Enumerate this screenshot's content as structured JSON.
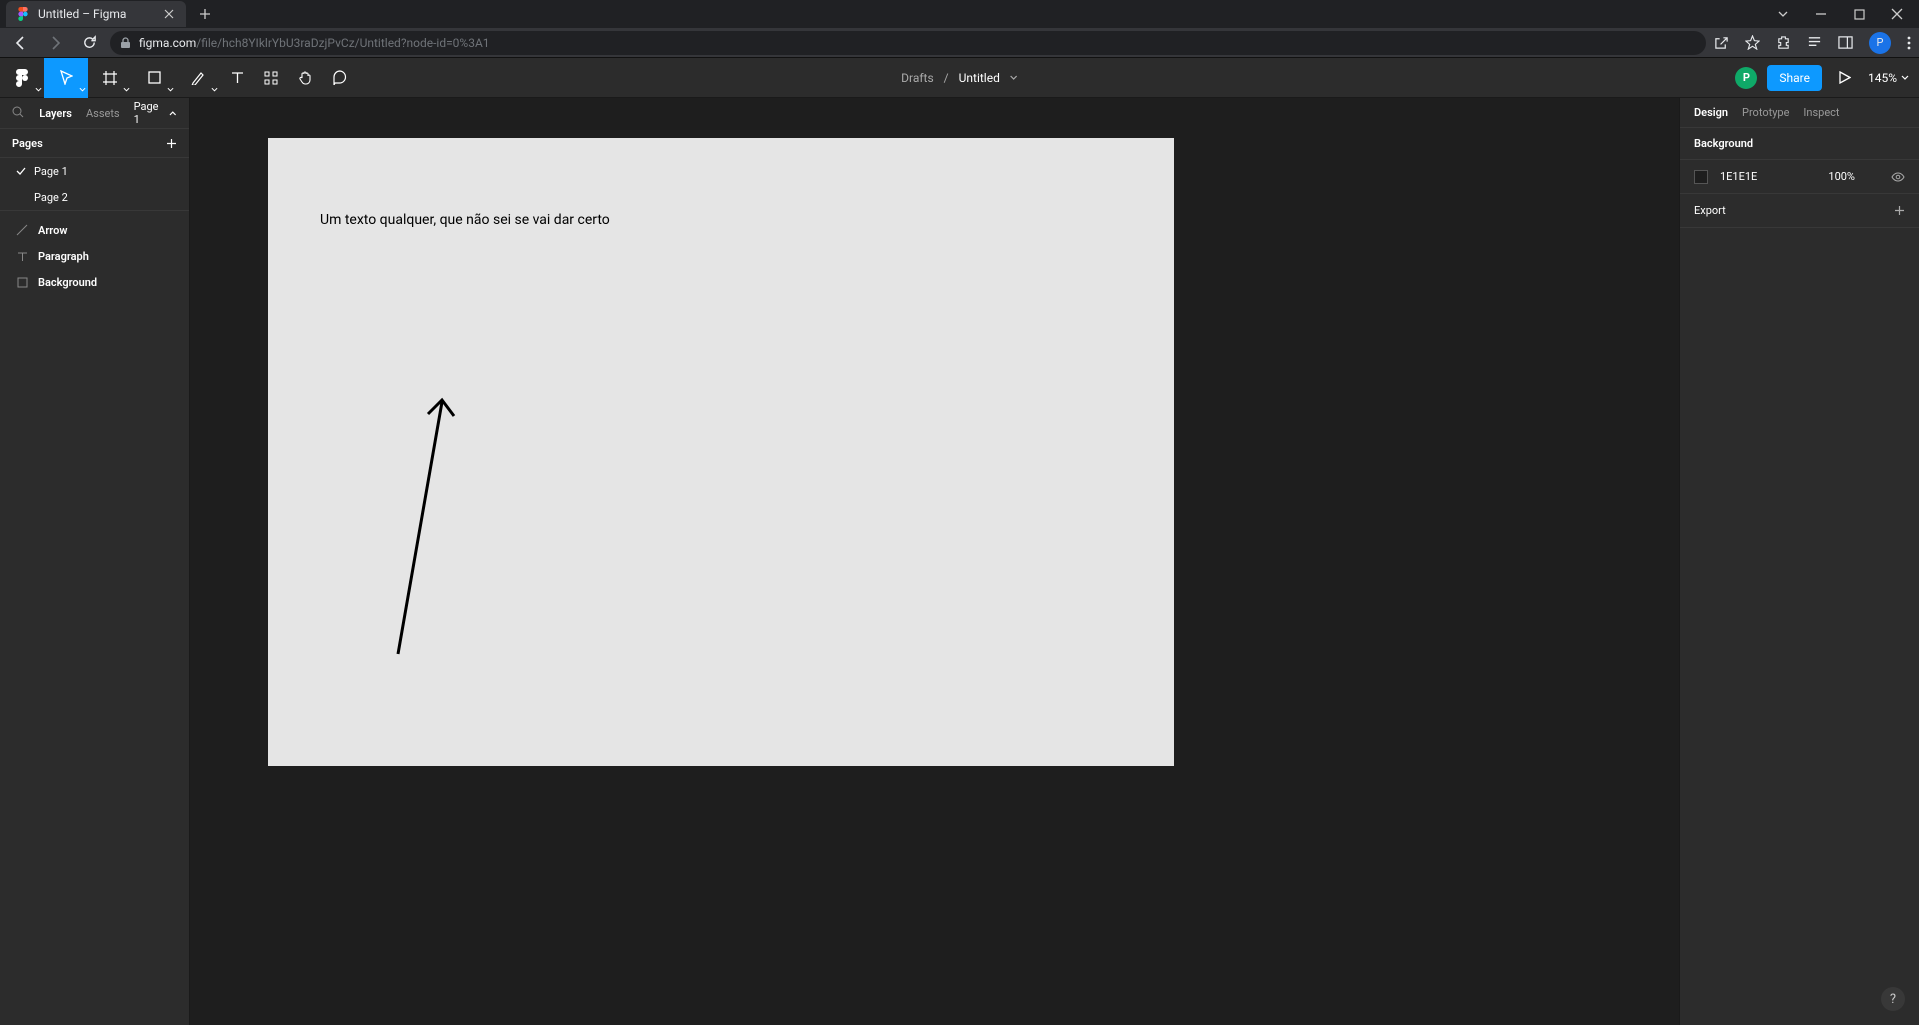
{
  "browser": {
    "tab_title": "Untitled – Figma",
    "url_host": "figma.com",
    "url_path": "/file/hch8YIklrYbU3raDzjPvCz/Untitled?node-id=0%3A1",
    "avatar_letter": "P"
  },
  "figma": {
    "breadcrumb_parent": "Drafts",
    "breadcrumb_doc": "Untitled",
    "avatar_letter": "P",
    "share_label": "Share",
    "zoom": "145%"
  },
  "left_panel": {
    "tab_layers": "Layers",
    "tab_assets": "Assets",
    "page_sel": "Page 1",
    "pages_label": "Pages",
    "pages": [
      "Page 1",
      "Page 2"
    ],
    "layers": [
      {
        "icon": "line",
        "name": "Arrow"
      },
      {
        "icon": "text",
        "name": "Paragraph"
      },
      {
        "icon": "rect",
        "name": "Background"
      }
    ]
  },
  "canvas": {
    "text": "Um texto qualquer, que não sei se vai dar certo"
  },
  "right_panel": {
    "tab_design": "Design",
    "tab_prototype": "Prototype",
    "tab_inspect": "Inspect",
    "background_label": "Background",
    "bg_hex": "1E1E1E",
    "bg_opacity": "100%",
    "export_label": "Export"
  },
  "help": "?"
}
